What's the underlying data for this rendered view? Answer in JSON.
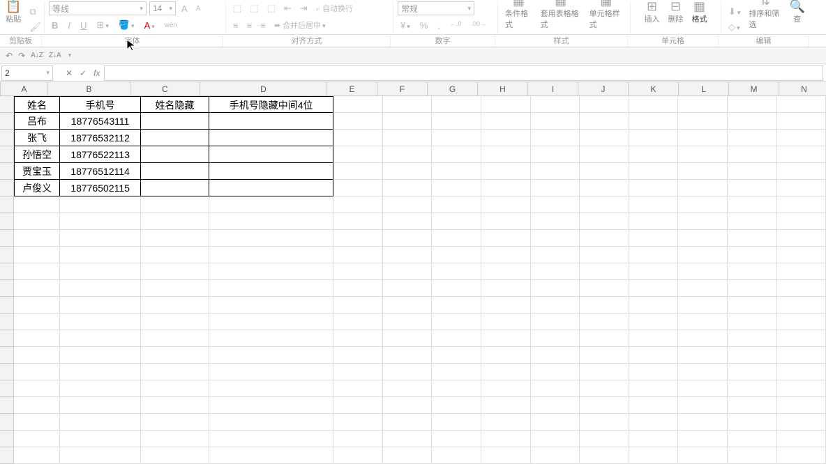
{
  "ribbon": {
    "paste": "贴",
    "paste_full": "粘贴",
    "font_name": "等线",
    "font_size": "14",
    "bold": "B",
    "italic": "I",
    "underline": "U",
    "ruby": "wén",
    "wrap": "自动换行",
    "merge": "合并后居中",
    "number_format": "常规",
    "pct": "%",
    "comma": ",",
    "dec_inc": "←.0",
    "dec_dec": ".00→",
    "cond_fmt": "条件格式",
    "tbl_fmt": "套用表格格式",
    "cell_fmt": "单元格样式",
    "insert": "插入",
    "delete": "删除",
    "format": "格式",
    "sort_filter": "排序和筛选",
    "find": "查"
  },
  "group_labels": {
    "clipboard": "剪贴板",
    "font": "字体",
    "align": "对齐方式",
    "number": "数字",
    "style": "样式",
    "cells": "单元格",
    "edit": "编辑"
  },
  "qat": {
    "undo": "↶",
    "redo": "↷",
    "sort_az": "A↓Z",
    "sort_za": "Z↓A"
  },
  "namebox": {
    "value": "2",
    "fx": "fx",
    "cancel": "✕",
    "confirm": "✓"
  },
  "columns": [
    {
      "label": "A",
      "w": 68
    },
    {
      "label": "B",
      "w": 118
    },
    {
      "label": "C",
      "w": 100
    },
    {
      "label": "D",
      "w": 182
    },
    {
      "label": "E",
      "w": 72
    },
    {
      "label": "F",
      "w": 72
    },
    {
      "label": "G",
      "w": 72
    },
    {
      "label": "H",
      "w": 72
    },
    {
      "label": "I",
      "w": 72
    },
    {
      "label": "J",
      "w": 72
    },
    {
      "label": "K",
      "w": 72
    },
    {
      "label": "L",
      "w": 72
    },
    {
      "label": "M",
      "w": 72
    },
    {
      "label": "N",
      "w": 72
    }
  ],
  "table": {
    "header": [
      "姓名",
      "手机号",
      "姓名隐藏",
      "手机号隐藏中间4位"
    ],
    "rows": [
      [
        "吕布",
        "18776543111",
        "",
        ""
      ],
      [
        "张飞",
        "18776532112",
        "",
        ""
      ],
      [
        "孙悟空",
        "18776522113",
        "",
        ""
      ],
      [
        "贾宝玉",
        "18776512114",
        "",
        ""
      ],
      [
        "卢俊义",
        "18776502115",
        "",
        ""
      ]
    ]
  },
  "blank_rows": 16
}
